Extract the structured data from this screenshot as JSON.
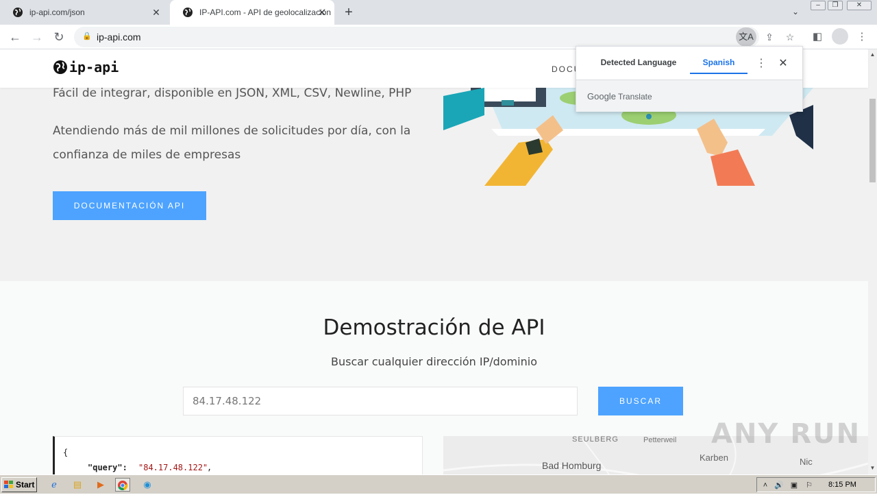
{
  "browser": {
    "tabs": [
      {
        "title": "ip-api.com/json",
        "active": false
      },
      {
        "title": "IP-API.com - API de geolocalización",
        "active": true
      }
    ],
    "new_tab": "+",
    "url": "ip-api.com",
    "close_symbol": "✕"
  },
  "site": {
    "logo_text": "ip-api",
    "nav_partial": "DOCU",
    "hero_line1": "Fácil de integrar, disponible en JSON, XML, CSV, Newline, PHP",
    "hero_line2": "Atendiendo más de mil millones de solicitudes por día, con la confianza de miles de empresas",
    "hero_button": "DOCUMENTACIÓN API",
    "demo_title": "Demostración de API",
    "demo_subtitle": "Buscar cualquier dirección IP/dominio",
    "ip_value": "84.17.48.122",
    "search_button": "BUSCAR",
    "json_open": "{",
    "json_key": "\"query\":",
    "json_value": "\"84.17.48.122\"",
    "json_comma": ",",
    "map_labels": [
      "SEULBERG",
      "Petterweil",
      "Bad Homburg",
      "Karben",
      "Nic"
    ]
  },
  "translate_popup": {
    "tab_detected": "Detected Language",
    "tab_target": "Spanish",
    "more": "⋮",
    "close": "✕",
    "brand_google": "Google",
    "brand_translate": "Translate"
  },
  "watermark": "ANY RUN",
  "taskbar": {
    "start_label": "Start",
    "clock": "8:15 PM"
  }
}
